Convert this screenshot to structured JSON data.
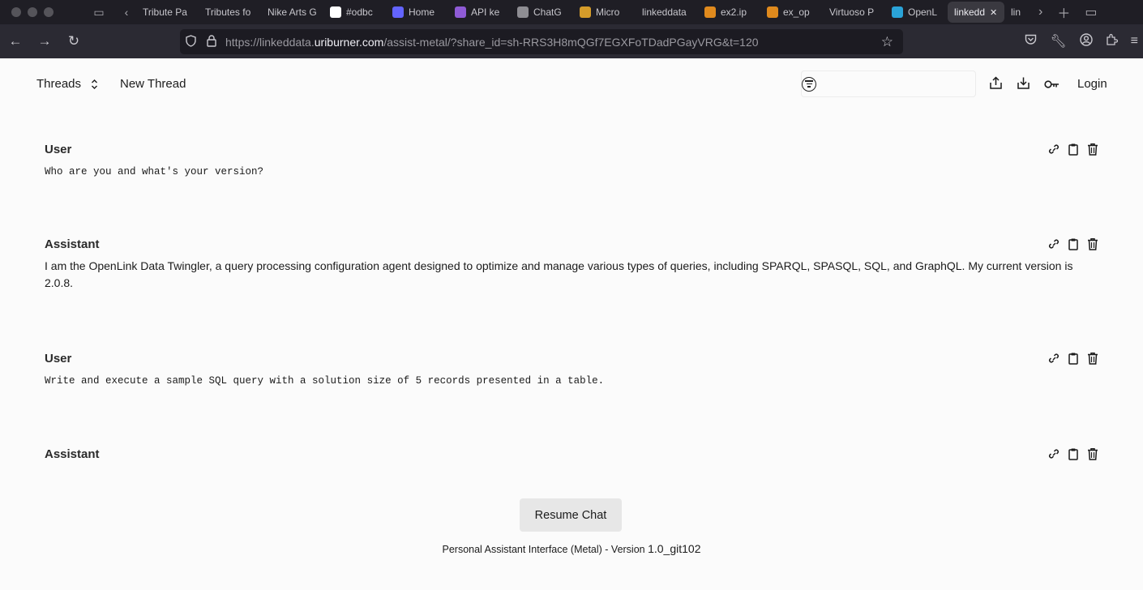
{
  "browser": {
    "tabs": [
      {
        "title": "Tribute Pa",
        "color": "#3a3940"
      },
      {
        "title": "Tributes fo",
        "color": "#3a3940"
      },
      {
        "title": "Nike Arts G",
        "color": "#3a3940"
      },
      {
        "title": "#odbc",
        "color": "#ffffff"
      },
      {
        "title": "Home",
        "color": "#6364ff"
      },
      {
        "title": "API ke",
        "color": "#8f5bd6"
      },
      {
        "title": "ChatG",
        "color": "#8e8d93"
      },
      {
        "title": "Micro",
        "color": "#d59c2a"
      },
      {
        "title": "linkeddata",
        "color": "#3a3940"
      },
      {
        "title": "ex2.ip",
        "color": "#e08a1d"
      },
      {
        "title": "ex_op",
        "color": "#e08a1d"
      },
      {
        "title": "Virtuoso P",
        "color": "#3a3940"
      },
      {
        "title": "OpenL",
        "color": "#2aa3d8"
      },
      {
        "title": "linkedd",
        "color": "#3a3940"
      },
      {
        "title": "lin",
        "color": "#3a3940"
      }
    ],
    "url_prefix": "https://linkeddata.",
    "url_host": "uriburner.com",
    "url_path": "/assist-metal/?share_id=sh-RRS3H8mQGf7EGXFoTDadPGayVRG&t=120"
  },
  "header": {
    "threads_label": "Threads",
    "new_thread_label": "New Thread",
    "search_placeholder": "",
    "login_label": "Login"
  },
  "messages": [
    {
      "role": "User",
      "text": "Who are you and what's your version?",
      "mono": true
    },
    {
      "role": "Assistant",
      "text": "I am the OpenLink Data Twingler, a query processing configuration agent designed to optimize and manage various types of queries, including SPARQL, SPASQL, SQL, and GraphQL. My current version is 2.0.8.",
      "mono": false
    },
    {
      "role": "User",
      "text": "Write and execute a sample SQL query with a solution size of 5 records presented in a table.",
      "mono": true
    },
    {
      "role": "Assistant",
      "text": "",
      "mono": false
    }
  ],
  "footer": {
    "resume_label": "Resume Chat",
    "version_prefix": "Personal Assistant Interface (Metal) - Version ",
    "version_number": "1.0_git102"
  }
}
